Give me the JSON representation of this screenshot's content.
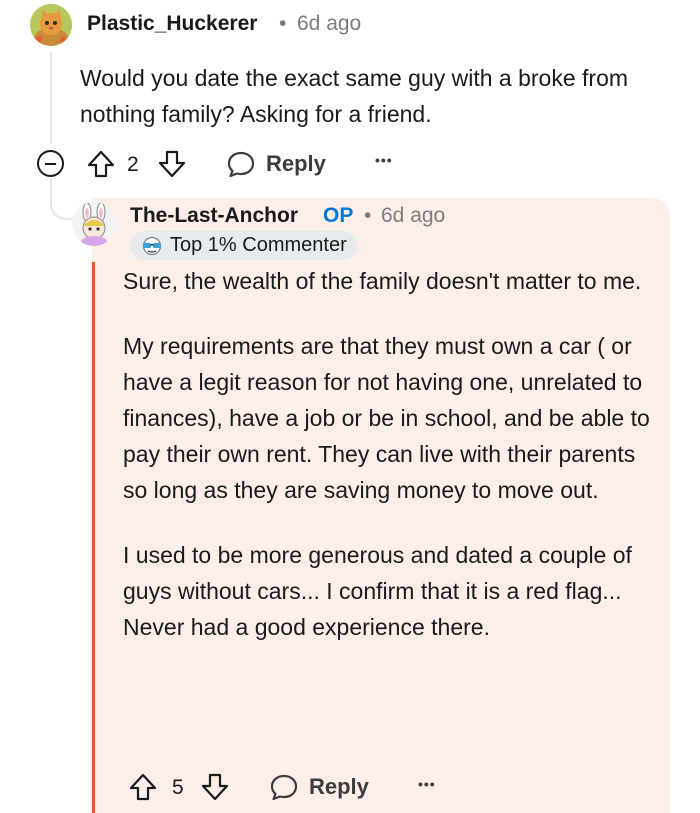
{
  "parent_comment": {
    "username": "Plastic_Huckerer",
    "separator": "•",
    "time": "6d ago",
    "body": "Would you date the exact same guy with a broke from nothing family? Asking for a friend.",
    "votes": "2",
    "reply_label": "Reply",
    "more_label": "•••",
    "avatar_icon": "cat-avatar-icon",
    "collapse_icon": "collapse-minus-icon"
  },
  "reply_comment": {
    "username": "The-Last-Anchor",
    "op_label": "OP",
    "separator": "•",
    "time": "6d ago",
    "badge_label": "Top 1% Commenter",
    "badge_icon": "sunglasses-icon",
    "avatar_icon": "bunny-avatar-icon",
    "paragraphs": [
      "Sure, the wealth of the family doesn't matter to me.",
      "My requirements are that they must own a car ( or have a legit reason for not having one, unrelated to finances), have a job or be in school, and be able to pay their own rent. They can live with their parents so long as they are saving money to move out.",
      "I used to be more generous and dated a couple of guys without cars... I confirm that it is a red flag... Never had a good experience there."
    ],
    "votes": "5",
    "reply_label": "Reply",
    "more_label": "•••"
  },
  "colors": {
    "op_blue": "#0079d3",
    "highlight_bg": "#fcefe9",
    "highlight_bar": "#e0592a",
    "muted": "#7c7c7c"
  }
}
